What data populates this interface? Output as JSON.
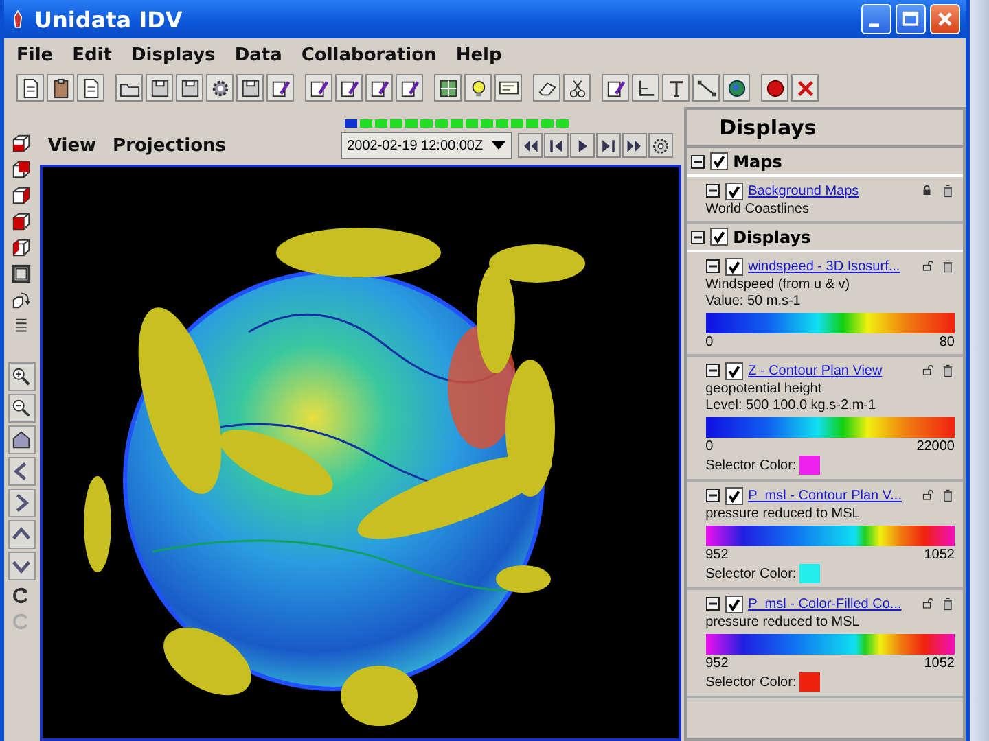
{
  "window": {
    "title": "Unidata IDV"
  },
  "menu": [
    "File",
    "Edit",
    "Displays",
    "Data",
    "Collaboration",
    "Help"
  ],
  "view_menu": [
    "View",
    "Projections"
  ],
  "animation": {
    "time": "2002-02-19 12:00:00Z",
    "frames": [
      {
        "selected": true
      },
      {
        "selected": false
      },
      {
        "selected": false
      },
      {
        "selected": false
      },
      {
        "selected": false
      },
      {
        "selected": false
      },
      {
        "selected": false
      },
      {
        "selected": false
      },
      {
        "selected": false
      },
      {
        "selected": false
      },
      {
        "selected": false
      },
      {
        "selected": false
      },
      {
        "selected": false
      },
      {
        "selected": false
      },
      {
        "selected": false
      }
    ]
  },
  "panel": {
    "title": "Displays",
    "sections": [
      {
        "title": "Maps",
        "checked": true,
        "expanded": true,
        "items": [
          {
            "name": "Background Maps",
            "checked": true,
            "expanded": true,
            "locked": true,
            "lines": [
              "World Coastlines"
            ]
          }
        ]
      },
      {
        "title": "Displays",
        "checked": true,
        "expanded": true,
        "items": [
          {
            "name": "windspeed - 3D Isosurf...",
            "checked": true,
            "expanded": true,
            "locked": false,
            "lines": [
              "Windspeed (from u & v)",
              "Value: 50 m.s-1"
            ],
            "scale": {
              "kind": "rainbow",
              "min": "0",
              "max": "80"
            }
          },
          {
            "name": "Z - Contour Plan View",
            "checked": true,
            "expanded": true,
            "locked": false,
            "lines": [
              "geopotential height",
              "Level: 500 100.0 kg.s-2.m-1"
            ],
            "scale": {
              "kind": "rainbow",
              "min": "0",
              "max": "22000"
            },
            "selector": {
              "label": "Selector Color:",
              "color": "#ee22ee"
            }
          },
          {
            "name": "P_msl - Contour Plan V...",
            "checked": true,
            "expanded": true,
            "locked": false,
            "lines": [
              "pressure reduced to MSL"
            ],
            "scale": {
              "kind": "wrap",
              "min": "952",
              "max": "1052"
            },
            "selector": {
              "label": "Selector Color:",
              "color": "#22eeee"
            }
          },
          {
            "name": "P_msl - Color-Filled Co...",
            "checked": true,
            "expanded": true,
            "locked": false,
            "lines": [
              "pressure reduced to MSL"
            ],
            "scale": {
              "kind": "wrap",
              "min": "952",
              "max": "1052"
            },
            "selector": {
              "label": "Selector Color:",
              "color": "#ee2211"
            }
          }
        ]
      }
    ]
  }
}
